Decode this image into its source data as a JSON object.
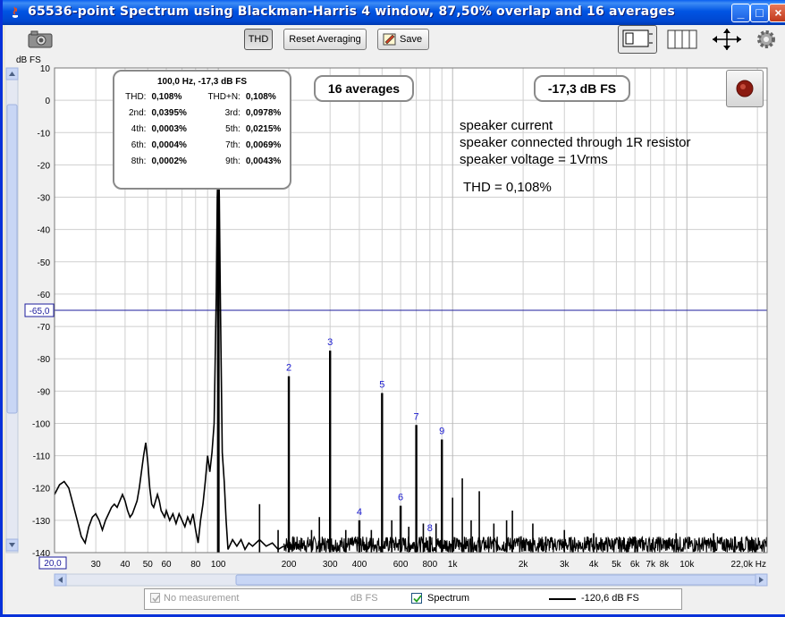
{
  "window": {
    "title": "65536-point Spectrum using Blackman-Harris 4 window, 87,50% overlap and 16 averages",
    "minimize": "_",
    "maximize": "□",
    "close": "×"
  },
  "toolbar": {
    "thd_label": "THD",
    "reset_label": "Reset Averaging",
    "save_label": "Save"
  },
  "plot": {
    "y_unit_label": "dB FS",
    "x_unit_label": "Hz",
    "cursor_level_label": "-65,0",
    "x_start_label": "20,0",
    "x_end_label": "22,0k Hz",
    "averages_badge": "16 averages",
    "level_badge": "-17,3 dB FS",
    "annotations": [
      "speaker current",
      "speaker connected through 1R resistor",
      "speaker voltage = 1Vrms",
      "THD = 0,108%"
    ],
    "thd_box": {
      "header": "100,0 Hz, -17,3 dB FS",
      "rows": [
        [
          "THD:",
          "0,108%",
          "THD+N:",
          "0,108%"
        ],
        [
          "2nd:",
          "0,0395%",
          "3rd:",
          "0,0978%"
        ],
        [
          "4th:",
          "0,0003%",
          "5th:",
          "0,0215%"
        ],
        [
          "6th:",
          "0,0004%",
          "7th:",
          "0,0069%"
        ],
        [
          "8th:",
          "0,0002%",
          "9th:",
          "0,0043%"
        ]
      ]
    }
  },
  "status": {
    "no_measurement_label": "No measurement",
    "no_measurement_unit": "dB FS",
    "spectrum_label": "Spectrum",
    "spectrum_value": "-120,6 dB FS"
  },
  "colors": {
    "trace": "#000000",
    "harmonic_label": "#1a1ad0",
    "cursor_line": "#1c1c9c",
    "grid": "#cfcfcf"
  },
  "chart_data": {
    "type": "line",
    "x_scale": "log",
    "xlim": [
      20,
      22000
    ],
    "ylim": [
      -140,
      10
    ],
    "y_ticks": [
      10,
      0,
      -10,
      -20,
      -30,
      -40,
      -50,
      -60,
      -70,
      -80,
      -90,
      -100,
      -110,
      -120,
      -130,
      -140
    ],
    "x_ticks": [
      {
        "v": 30,
        "label": "30"
      },
      {
        "v": 40,
        "label": "40"
      },
      {
        "v": 50,
        "label": "50"
      },
      {
        "v": 60,
        "label": "60"
      },
      {
        "v": 80,
        "label": "80"
      },
      {
        "v": 100,
        "label": "100"
      },
      {
        "v": 200,
        "label": "200"
      },
      {
        "v": 300,
        "label": "300"
      },
      {
        "v": 400,
        "label": "400"
      },
      {
        "v": 600,
        "label": "600"
      },
      {
        "v": 800,
        "label": "800"
      },
      {
        "v": 1000,
        "label": "1k"
      },
      {
        "v": 2000,
        "label": "2k"
      },
      {
        "v": 3000,
        "label": "3k"
      },
      {
        "v": 4000,
        "label": "4k"
      },
      {
        "v": 5000,
        "label": "5k"
      },
      {
        "v": 6000,
        "label": "6k"
      },
      {
        "v": 7000,
        "label": "7k"
      },
      {
        "v": 8000,
        "label": "8k"
      },
      {
        "v": 10000,
        "label": "10k"
      }
    ],
    "cursor_level": -65,
    "grid": true,
    "fundamental": {
      "freq": 100,
      "level": -17.3
    },
    "harmonics": [
      {
        "n": "2",
        "freq": 200,
        "level": -85.4
      },
      {
        "n": "3",
        "freq": 300,
        "level": -77.5
      },
      {
        "n": "4",
        "freq": 400,
        "level": -130
      },
      {
        "n": "5",
        "freq": 500,
        "level": -90.6
      },
      {
        "n": "6",
        "freq": 600,
        "level": -125.5
      },
      {
        "n": "7",
        "freq": 700,
        "level": -100.5
      },
      {
        "n": "8",
        "freq": 800,
        "level": -135
      },
      {
        "n": "9",
        "freq": 900,
        "level": -105.0
      }
    ],
    "noise_floor": [
      [
        20,
        -122
      ],
      [
        21,
        -119
      ],
      [
        22,
        -118
      ],
      [
        23,
        -120
      ],
      [
        24,
        -125
      ],
      [
        25,
        -130
      ],
      [
        26,
        -135
      ],
      [
        27,
        -137
      ],
      [
        28,
        -132
      ],
      [
        29,
        -129
      ],
      [
        30,
        -128
      ],
      [
        31,
        -130
      ],
      [
        32,
        -133
      ],
      [
        33,
        -130
      ],
      [
        34,
        -128
      ],
      [
        35,
        -126
      ],
      [
        36,
        -125
      ],
      [
        37,
        -126
      ],
      [
        38,
        -124
      ],
      [
        39,
        -122
      ],
      [
        40,
        -124
      ],
      [
        41,
        -127
      ],
      [
        42,
        -129
      ],
      [
        43,
        -128
      ],
      [
        44,
        -126
      ],
      [
        45,
        -124
      ],
      [
        46,
        -120
      ],
      [
        47,
        -115
      ],
      [
        48,
        -110
      ],
      [
        49,
        -106
      ],
      [
        50,
        -112
      ],
      [
        51,
        -120
      ],
      [
        52,
        -125
      ],
      [
        53,
        -126
      ],
      [
        54,
        -124
      ],
      [
        55,
        -122
      ],
      [
        56,
        -124
      ],
      [
        57,
        -127
      ],
      [
        58,
        -128
      ],
      [
        59,
        -129
      ],
      [
        60,
        -127
      ],
      [
        62,
        -130
      ],
      [
        64,
        -128
      ],
      [
        66,
        -131
      ],
      [
        68,
        -128
      ],
      [
        70,
        -130
      ],
      [
        72,
        -132
      ],
      [
        74,
        -129
      ],
      [
        76,
        -131
      ],
      [
        78,
        -128
      ],
      [
        80,
        -133
      ],
      [
        82,
        -137
      ],
      [
        84,
        -130
      ],
      [
        86,
        -125
      ],
      [
        88,
        -118
      ],
      [
        90,
        -110
      ],
      [
        92,
        -115
      ],
      [
        94,
        -109
      ],
      [
        96,
        -100
      ],
      [
        98,
        -60
      ],
      [
        99,
        -30
      ],
      [
        100,
        -17.3
      ],
      [
        101,
        -30
      ],
      [
        102,
        -60
      ],
      [
        104,
        -109
      ],
      [
        106,
        -118
      ],
      [
        108,
        -130
      ],
      [
        110,
        -139
      ],
      [
        115,
        -136
      ],
      [
        120,
        -138
      ],
      [
        125,
        -136
      ],
      [
        130,
        -139
      ],
      [
        135,
        -137
      ],
      [
        140,
        -138
      ],
      [
        150,
        -136
      ],
      [
        160,
        -138
      ],
      [
        170,
        -137
      ],
      [
        180,
        -139
      ],
      [
        190,
        -138
      ]
    ]
  }
}
